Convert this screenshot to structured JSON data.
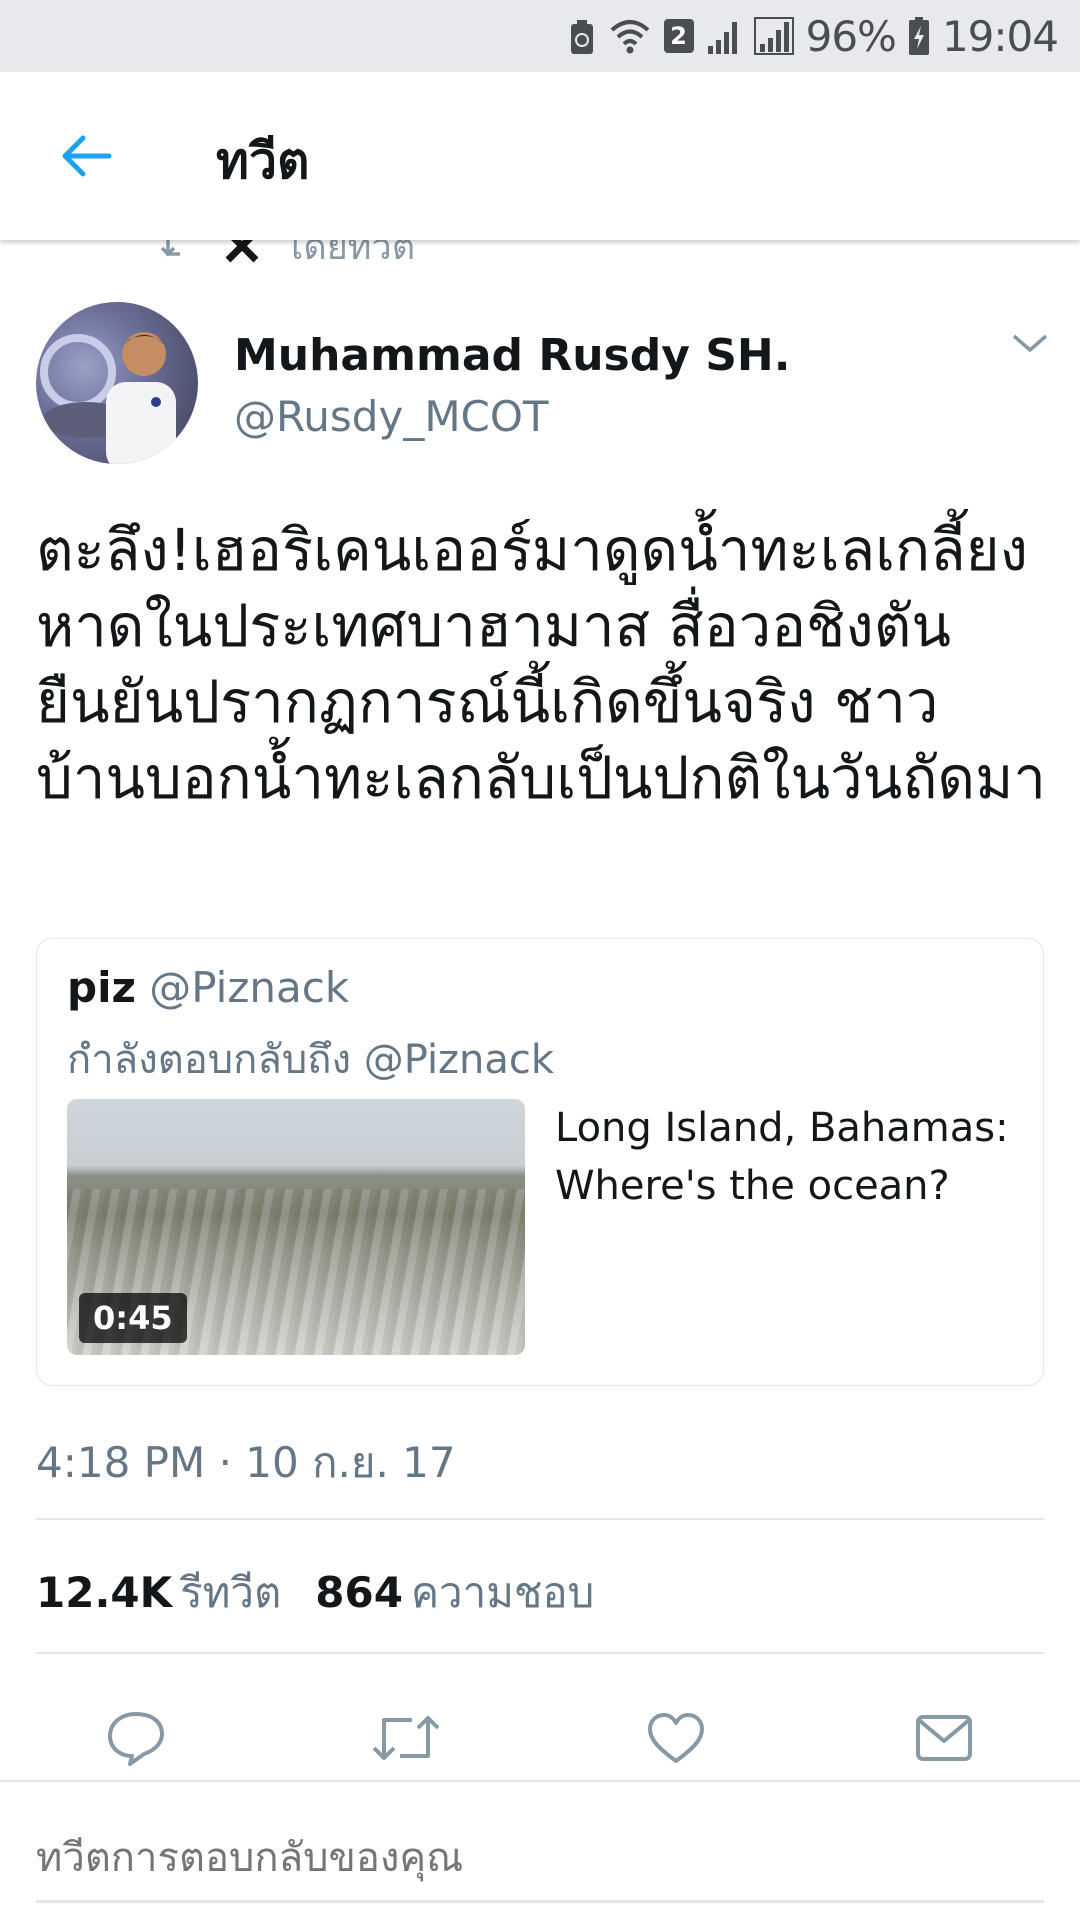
{
  "status_bar": {
    "signal_badge": "2",
    "battery_percent": "96%",
    "time": "19:04"
  },
  "app_bar": {
    "title": "ทวีต",
    "back_icon": "back-arrow-icon"
  },
  "context_row": {
    "text": "โดยทวีต"
  },
  "tweet": {
    "author_name": "Muhammad Rusdy SH.",
    "author_handle": "@Rusdy_MCOT",
    "text": "ตะลึง!เฮอริเคนเออร์มาดูดน้ำทะเลเกลี้ยงหาดในประเทศบาฮามาส สื่อวอชิงตันยืนยันปรากฏการณ์นี้เกิดขึ้นจริง ชาวบ้านบอกน้ำทะเลกลับเป็นปกติในวันถัดมา",
    "timestamp": "4:18 PM · 10 ก.ย. 17",
    "stats": {
      "retweets_count": "12.4K",
      "retweets_label": "รีทวีต",
      "likes_count": "864",
      "likes_label": "ความชอบ"
    }
  },
  "quote": {
    "name": "piz",
    "handle": "@Piznack",
    "reply_to": "กำลังตอบกลับถึง @Piznack",
    "video_duration": "0:45",
    "text": "Long Island, Bahamas: Where's the ocean?"
  },
  "actions": [
    "reply-icon",
    "retweet-icon",
    "like-icon",
    "share-mail-icon"
  ],
  "reply_box": {
    "placeholder": "ทวีตการตอบกลับของคุณ"
  },
  "colors": {
    "accent": "#1da1f2",
    "secondary_text": "#657786",
    "icon_gray": "#8899a6"
  }
}
